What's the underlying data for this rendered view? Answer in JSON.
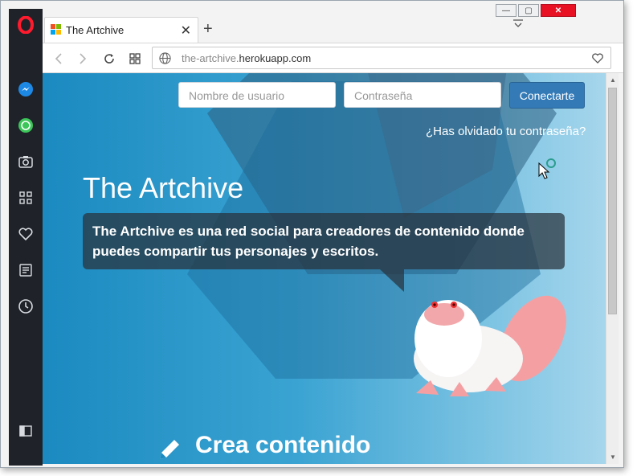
{
  "tab": {
    "title": "The Artchive",
    "close_glyph": "✕",
    "new_tab_glyph": "+"
  },
  "window_controls": {
    "minimize": "—",
    "maximize": "▢",
    "close": "✕"
  },
  "address_bar": {
    "url_domain_prefix": "the-artchive.",
    "url_domain_main": "herokuapp.com"
  },
  "page": {
    "username_placeholder": "Nombre de usuario",
    "password_placeholder": "Contraseña",
    "login_button": "Conectarte",
    "forgot_password": "¿Has olvidado tu contraseña?",
    "hero_title": "The Artchive",
    "hero_description": "The Artchive es una red social para creadores de contenido donde puedes compartir tus personajes y escritos.",
    "section_title": "Crea contenido"
  },
  "sidebar_icons": [
    "opera-logo-icon",
    "messenger-icon",
    "whatsapp-icon",
    "camera-icon",
    "speed-dial-icon",
    "heart-icon",
    "news-icon",
    "history-icon",
    "sidebar-toggle-icon"
  ],
  "colors": {
    "login_button": "#337ab7",
    "opera_red": "#ff1b2d",
    "hero_gradient_start": "#1b8ac0",
    "hero_gradient_end": "#a6d6ec"
  }
}
